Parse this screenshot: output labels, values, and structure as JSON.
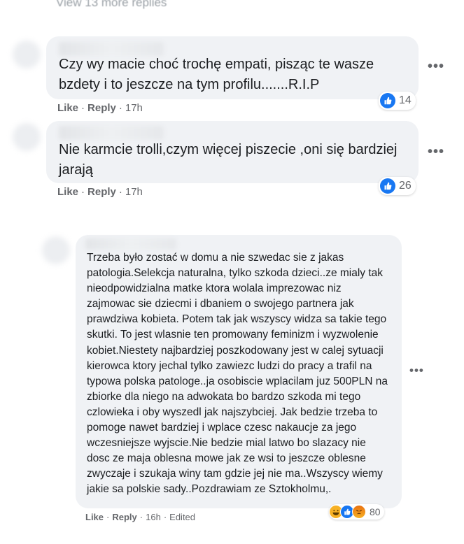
{
  "header": {
    "view_more_replies": "View 13 more replies"
  },
  "comments": [
    {
      "text": "Czy wy macie choć trochę empati, pisząc te wasze bzdety i to jeszcze na tym profilu.......R.I.P",
      "like": "Like",
      "reply": "Reply",
      "time": "17h",
      "reactions": {
        "count": "14",
        "icons": [
          "like-icon"
        ]
      },
      "more": "•••"
    },
    {
      "text": "Nie karmcie trolli,czym więcej piszecie ,oni się bardziej jarają",
      "like": "Like",
      "reply": "Reply",
      "time": "17h",
      "reactions": {
        "count": "26",
        "icons": [
          "like-icon"
        ]
      },
      "more": "•••"
    },
    {
      "text": "Trzeba było zostać w domu a nie szwedac sie z jakas patologia.Selekcja naturalna, tylko szkoda dzieci..ze mialy tak nieodpowidzialna matke ktora wolala imprezowac niz zajmowac sie dziecmi i dbaniem o swojego partnera jak prawdziwa kobieta. Potem tak jak wszyscy widza sa takie tego skutki. To jest wlasnie ten promowany feminizm i wyzwolenie kobiet.Niestety najbardziej poszkodowany jest w calej sytuacji kierowca ktory jechal tylko zawiezc ludzi do pracy a trafil na typowa polska patologe..ja osobiscie wplacilam juz 500PLN na zbiorke dla niego na adwokata bo bardzo szkoda mi tego czlowieka i oby wyszedl jak najszybciej. Jak bedzie trzeba to pomoge nawet bardziej i wplace czesc nakaucje za jego wczesniejsze wyjscie.Nie bedzie mial latwo bo slazacy nie dosc ze maja oblesna mowe jak ze wsi to jeszcze oblesne zwyczaje i szukaja winy tam gdzie jej nie ma..Wszyscy wiemy jakie sa polskie sady..Pozdrawiam ze Sztokholmu,.",
      "like": "Like",
      "reply": "Reply",
      "time": "16h",
      "edited": "Edited",
      "reactions": {
        "count": "80",
        "icons": [
          "haha-icon",
          "like-icon",
          "angry-icon"
        ]
      },
      "more": "•••"
    }
  ],
  "colors": {
    "bubble": "#f0f2f5",
    "meta": "#65676b",
    "like_blue": "#1877f2",
    "haha_yellow": "#f7b125",
    "angry_orange": "#e9710f"
  }
}
